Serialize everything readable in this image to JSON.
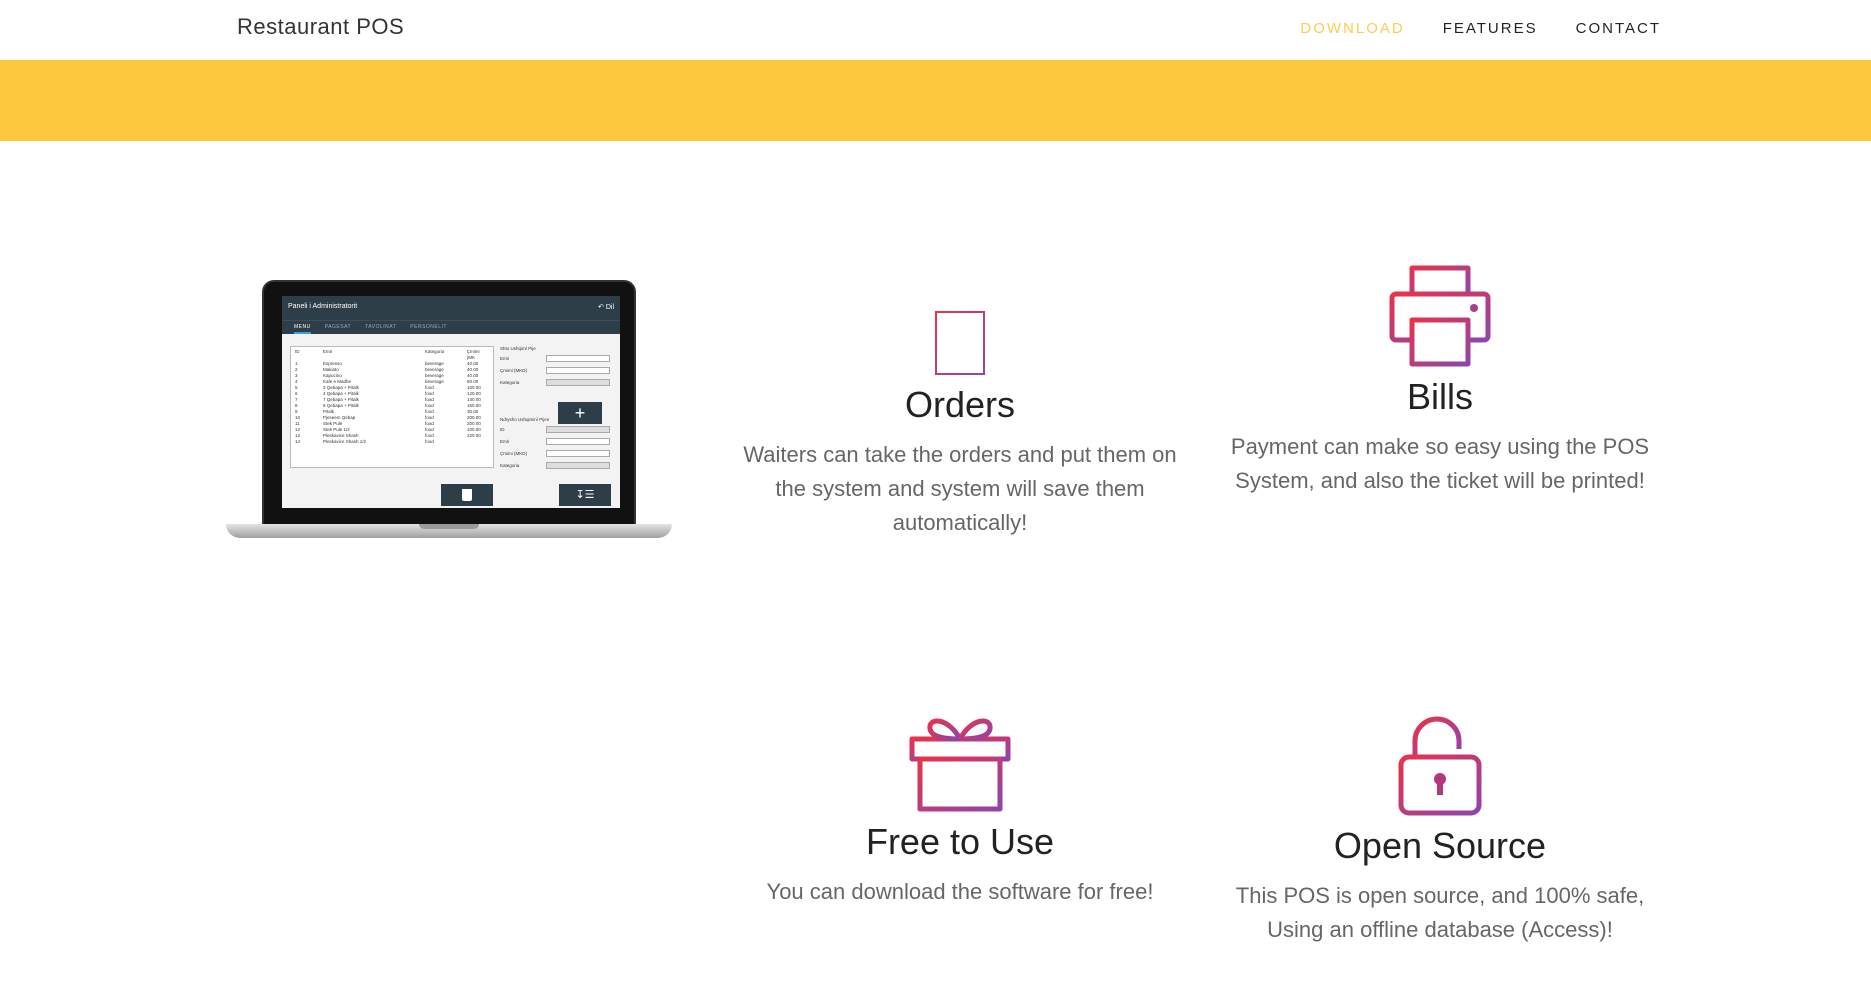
{
  "nav": {
    "brand": "Restaurant POS",
    "links": [
      "DOWNLOAD",
      "FEATURES",
      "CONTACT"
    ]
  },
  "colors": {
    "accent": "#fdcc52",
    "banner": "#fdc73d",
    "icon_gradient_start": "#e8334a",
    "icon_gradient_end": "#8e44ad"
  },
  "laptop_app": {
    "title": "Paneli i Administratorit",
    "exit": "Dil",
    "tabs": [
      "MENU",
      "PAGESAT",
      "TAVOLINAT",
      "PERSONELIT"
    ],
    "table_header": [
      "ID",
      "Emri",
      "Kategoria",
      "Çmimi (MK"
    ],
    "rows": [
      [
        "1",
        "Espresso",
        "beverage",
        "40.00"
      ],
      [
        "2",
        "Makiato",
        "beverage",
        "40.00"
      ],
      [
        "3",
        "Kapucino",
        "beverage",
        "40.00"
      ],
      [
        "4",
        "Kafe e Madhe",
        "beverage",
        "50.00"
      ],
      [
        "5",
        "3 Qebapa + Pitalk",
        "food",
        "100.00"
      ],
      [
        "6",
        "4 Qebapa + Pitalk",
        "food",
        "120.00"
      ],
      [
        "7",
        "7 Qebapa + Pitalk",
        "food",
        "140.00"
      ],
      [
        "8",
        "8 Qebapa + Pitalk",
        "food",
        "160.00"
      ],
      [
        "9",
        "Pitalk",
        "food",
        "30.00"
      ],
      [
        "10",
        "Pjeseem Qebap",
        "food",
        "200.00"
      ],
      [
        "11",
        "Stek Pule",
        "food",
        "200.00"
      ],
      [
        "12",
        "Stek Pule 1/2",
        "food",
        "100.00"
      ],
      [
        "13",
        "Pleskavice Shash",
        "food",
        "220.00"
      ],
      [
        "14",
        "Pleskavice Shash 1/2",
        "food",
        ""
      ]
    ],
    "right_section1": "Shto Ushqim/ Pije",
    "right_labels1": [
      "Emri",
      "Çmimi (MKD)",
      "Kategoria"
    ],
    "right_section2": "Ndrysho Ushqimin/ Pijen",
    "right_labels2": [
      "ID",
      "Emri",
      "Çmimi (MKD)",
      "Kategoria"
    ],
    "plus": "+",
    "sort": "↧☰"
  },
  "features": [
    {
      "icon": "tablet-icon",
      "title": "Orders",
      "desc": "Waiters can take the orders and put them on the system and system will save them automatically!"
    },
    {
      "icon": "printer-icon",
      "title": "Bills",
      "desc": "Payment can make so easy using the POS System, and also the ticket will be printed!"
    },
    {
      "icon": "gift-icon",
      "title": "Free to Use",
      "desc": "You can download the software for free!"
    },
    {
      "icon": "unlock-icon",
      "title": "Open Source",
      "desc": "This POS is open source, and 100% safe, Using an offline database (Access)!"
    }
  ]
}
